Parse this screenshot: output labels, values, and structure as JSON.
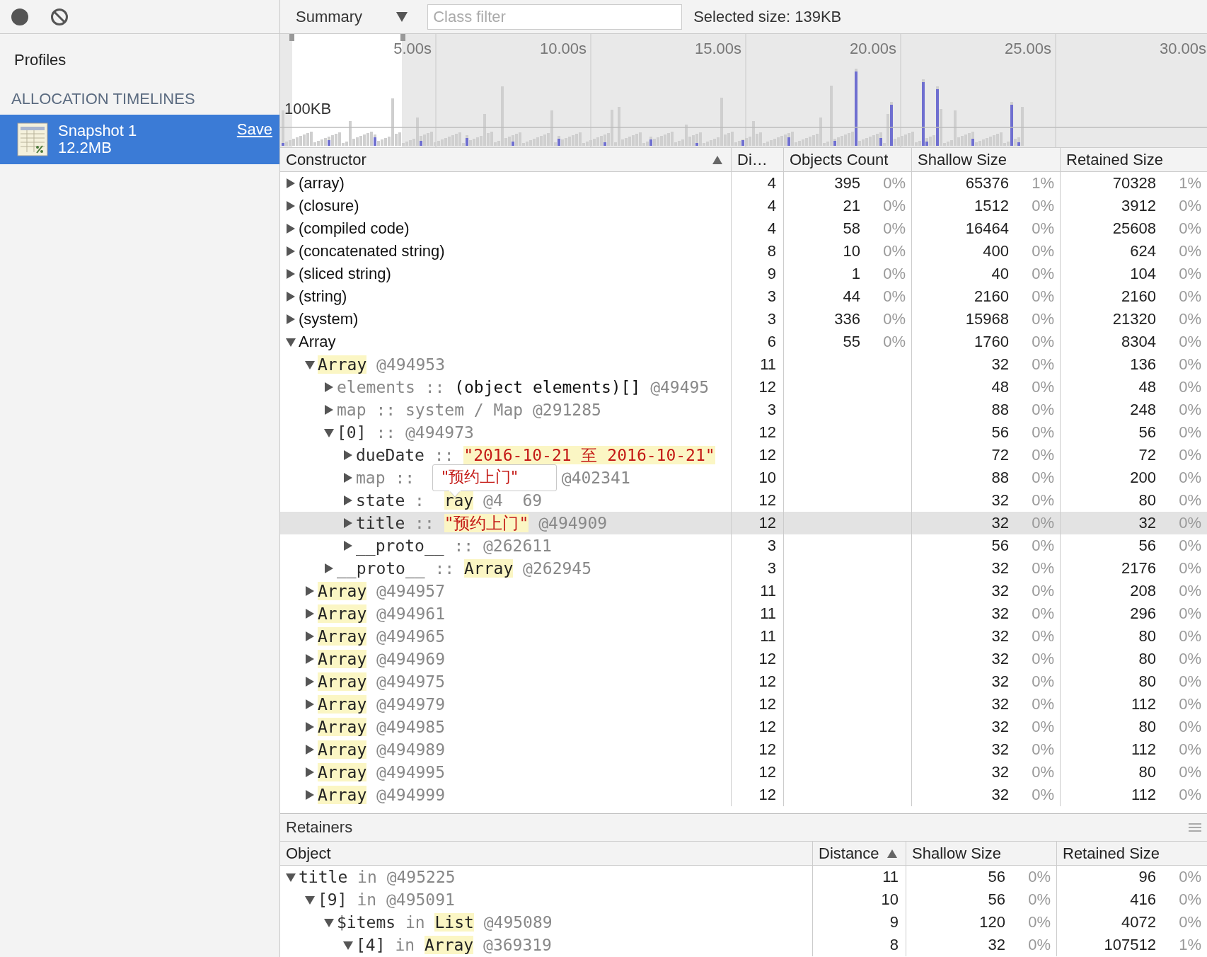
{
  "sidebar": {
    "heading": "Profiles",
    "section": "ALLOCATION TIMELINES",
    "snapshots": [
      {
        "name": "Snapshot 1",
        "size": "12.2MB",
        "action": "Save",
        "selected": true
      }
    ]
  },
  "toolbar": {
    "view": "Summary",
    "filter_placeholder": "Class filter",
    "selected_size": "Selected size: 139KB"
  },
  "timeline": {
    "ticks": [
      "5.00s",
      "10.00s",
      "15.00s",
      "20.00s",
      "25.00s",
      "30.00s"
    ],
    "scale_label": "100KB"
  },
  "table": {
    "columns": [
      {
        "label": "Constructor",
        "sorted": true
      },
      {
        "label": "Di…",
        "sorted": false
      },
      {
        "label": "Objects Count",
        "sorted": false
      },
      {
        "label": "Shallow Size",
        "sorted": false
      },
      {
        "label": "Retained Size",
        "sorted": false
      }
    ],
    "rows": [
      {
        "kind": "constructor",
        "parts": [
          {
            "text": "(array)",
            "kind": "plain"
          }
        ],
        "expanded": false,
        "selected": false,
        "distance": "4",
        "count": "395",
        "count_pct": "0%",
        "shallow": "65376",
        "shallow_pct": "1%",
        "retained": "70328",
        "retained_pct": "1%"
      },
      {
        "kind": "constructor",
        "parts": [
          {
            "text": "(closure)",
            "kind": "plain"
          }
        ],
        "expanded": false,
        "selected": false,
        "distance": "4",
        "count": "21",
        "count_pct": "0%",
        "shallow": "1512",
        "shallow_pct": "0%",
        "retained": "3912",
        "retained_pct": "0%"
      },
      {
        "kind": "constructor",
        "parts": [
          {
            "text": "(compiled code)",
            "kind": "plain"
          }
        ],
        "expanded": false,
        "selected": false,
        "distance": "4",
        "count": "58",
        "count_pct": "0%",
        "shallow": "16464",
        "shallow_pct": "0%",
        "retained": "25608",
        "retained_pct": "0%"
      },
      {
        "kind": "constructor",
        "parts": [
          {
            "text": "(concatenated string)",
            "kind": "plain"
          }
        ],
        "expanded": false,
        "selected": false,
        "distance": "8",
        "count": "10",
        "count_pct": "0%",
        "shallow": "400",
        "shallow_pct": "0%",
        "retained": "624",
        "retained_pct": "0%"
      },
      {
        "kind": "constructor",
        "parts": [
          {
            "text": "(sliced string)",
            "kind": "plain"
          }
        ],
        "expanded": false,
        "selected": false,
        "distance": "9",
        "count": "1",
        "count_pct": "0%",
        "shallow": "40",
        "shallow_pct": "0%",
        "retained": "104",
        "retained_pct": "0%"
      },
      {
        "kind": "constructor",
        "parts": [
          {
            "text": "(string)",
            "kind": "plain"
          }
        ],
        "expanded": false,
        "selected": false,
        "distance": "3",
        "count": "44",
        "count_pct": "0%",
        "shallow": "2160",
        "shallow_pct": "0%",
        "retained": "2160",
        "retained_pct": "0%"
      },
      {
        "kind": "constructor",
        "parts": [
          {
            "text": "(system)",
            "kind": "plain"
          }
        ],
        "expanded": false,
        "selected": false,
        "distance": "3",
        "count": "336",
        "count_pct": "0%",
        "shallow": "15968",
        "shallow_pct": "0%",
        "retained": "21320",
        "retained_pct": "0%"
      },
      {
        "kind": "constructor",
        "parts": [
          {
            "text": "Array",
            "kind": "plain"
          }
        ],
        "expanded": true,
        "selected": false,
        "distance": "6",
        "count": "55",
        "count_pct": "0%",
        "shallow": "1760",
        "shallow_pct": "0%",
        "retained": "8304",
        "retained_pct": "0%",
        "children": [
          {
            "kind": "object",
            "parts": [
              {
                "text": "Array",
                "kind": "class"
              },
              {
                "text": "@494953",
                "kind": "id"
              }
            ],
            "expanded": true,
            "selected": false,
            "distance": "11",
            "shallow": "32",
            "shallow_pct": "0%",
            "retained": "136",
            "retained_pct": "0%",
            "children": [
              {
                "kind": "object",
                "parts": [
                  {
                    "text": "elements",
                    "kind": "hidden-key"
                  },
                  {
                    "text": "::",
                    "kind": "sep"
                  },
                  {
                    "text": "(object elements)[]",
                    "kind": "plain"
                  },
                  {
                    "text": "@49495",
                    "kind": "id"
                  }
                ],
                "expanded": false,
                "selected": false,
                "distance": "12",
                "shallow": "48",
                "shallow_pct": "0%",
                "retained": "48",
                "retained_pct": "0%"
              },
              {
                "kind": "object",
                "parts": [
                  {
                    "text": "map",
                    "kind": "hidden-key"
                  },
                  {
                    "text": "::",
                    "kind": "sep"
                  },
                  {
                    "text": "system / Map",
                    "kind": "dim"
                  },
                  {
                    "text": "@291285",
                    "kind": "id"
                  }
                ],
                "expanded": false,
                "selected": false,
                "distance": "3",
                "shallow": "88",
                "shallow_pct": "0%",
                "retained": "248",
                "retained_pct": "0%"
              },
              {
                "kind": "object",
                "parts": [
                  {
                    "text": "[0]",
                    "kind": "key"
                  },
                  {
                    "text": "::",
                    "kind": "sep"
                  },
                  {
                    "text": "@494973",
                    "kind": "id"
                  }
                ],
                "expanded": true,
                "selected": false,
                "distance": "12",
                "shallow": "56",
                "shallow_pct": "0%",
                "retained": "56",
                "retained_pct": "0%",
                "children": [
                  {
                    "kind": "object",
                    "parts": [
                      {
                        "text": "dueDate",
                        "kind": "key"
                      },
                      {
                        "text": "::",
                        "kind": "sep"
                      },
                      {
                        "text": "\"2016-10-21 至 2016-10-21\"",
                        "kind": "string"
                      }
                    ],
                    "expanded": false,
                    "selected": false,
                    "distance": "12",
                    "shallow": "72",
                    "shallow_pct": "0%",
                    "retained": "72",
                    "retained_pct": "0%"
                  },
                  {
                    "kind": "object",
                    "parts": [
                      {
                        "text": "map",
                        "kind": "hidden-key"
                      },
                      {
                        "text": "::",
                        "kind": "sep"
                      },
                      {
                        "text": "@402341",
                        "kind": "id",
                        "after_cover": true
                      }
                    ],
                    "expanded": false,
                    "selected": false,
                    "distance": "10",
                    "shallow": "88",
                    "shallow_pct": "0%",
                    "retained": "200",
                    "retained_pct": "0%"
                  },
                  {
                    "kind": "object",
                    "parts": [
                      {
                        "text": "state",
                        "kind": "key"
                      },
                      {
                        "text": ":",
                        "kind": "sep"
                      },
                      {
                        "text": "ray",
                        "kind": "class",
                        "after_cover": true
                      },
                      {
                        "text": "@4",
                        "kind": "id"
                      },
                      {
                        "text": "69",
                        "kind": "id",
                        "after_cover": true
                      }
                    ],
                    "expanded": false,
                    "selected": false,
                    "distance": "12",
                    "shallow": "32",
                    "shallow_pct": "0%",
                    "retained": "80",
                    "retained_pct": "0%"
                  },
                  {
                    "kind": "object",
                    "parts": [
                      {
                        "text": "title",
                        "kind": "key"
                      },
                      {
                        "text": "::",
                        "kind": "sep"
                      },
                      {
                        "text": "\"预约上门\"",
                        "kind": "string"
                      },
                      {
                        "text": "@494909",
                        "kind": "id"
                      }
                    ],
                    "expanded": false,
                    "selected": true,
                    "distance": "12",
                    "shallow": "32",
                    "shallow_pct": "0%",
                    "retained": "32",
                    "retained_pct": "0%"
                  },
                  {
                    "kind": "object",
                    "parts": [
                      {
                        "text": "__proto__",
                        "kind": "key"
                      },
                      {
                        "text": "::",
                        "kind": "sep"
                      },
                      {
                        "text": "@262611",
                        "kind": "id"
                      }
                    ],
                    "expanded": false,
                    "selected": false,
                    "distance": "3",
                    "shallow": "56",
                    "shallow_pct": "0%",
                    "retained": "56",
                    "retained_pct": "0%"
                  }
                ]
              },
              {
                "kind": "object",
                "parts": [
                  {
                    "text": "__proto__",
                    "kind": "key"
                  },
                  {
                    "text": "::",
                    "kind": "sep"
                  },
                  {
                    "text": "Array",
                    "kind": "class"
                  },
                  {
                    "text": "@262945",
                    "kind": "id"
                  }
                ],
                "expanded": false,
                "selected": false,
                "distance": "3",
                "shallow": "32",
                "shallow_pct": "0%",
                "retained": "2176",
                "retained_pct": "0%"
              }
            ]
          },
          {
            "kind": "object",
            "parts": [
              {
                "text": "Array",
                "kind": "class"
              },
              {
                "text": "@494957",
                "kind": "id"
              }
            ],
            "expanded": false,
            "selected": false,
            "distance": "11",
            "shallow": "32",
            "shallow_pct": "0%",
            "retained": "208",
            "retained_pct": "0%"
          },
          {
            "kind": "object",
            "parts": [
              {
                "text": "Array",
                "kind": "class"
              },
              {
                "text": "@494961",
                "kind": "id"
              }
            ],
            "expanded": false,
            "selected": false,
            "distance": "11",
            "shallow": "32",
            "shallow_pct": "0%",
            "retained": "296",
            "retained_pct": "0%"
          },
          {
            "kind": "object",
            "parts": [
              {
                "text": "Array",
                "kind": "class"
              },
              {
                "text": "@494965",
                "kind": "id"
              }
            ],
            "expanded": false,
            "selected": false,
            "distance": "11",
            "shallow": "32",
            "shallow_pct": "0%",
            "retained": "80",
            "retained_pct": "0%"
          },
          {
            "kind": "object",
            "parts": [
              {
                "text": "Array",
                "kind": "class"
              },
              {
                "text": "@494969",
                "kind": "id"
              }
            ],
            "expanded": false,
            "selected": false,
            "distance": "12",
            "shallow": "32",
            "shallow_pct": "0%",
            "retained": "80",
            "retained_pct": "0%"
          },
          {
            "kind": "object",
            "parts": [
              {
                "text": "Array",
                "kind": "class"
              },
              {
                "text": "@494975",
                "kind": "id"
              }
            ],
            "expanded": false,
            "selected": false,
            "distance": "12",
            "shallow": "32",
            "shallow_pct": "0%",
            "retained": "80",
            "retained_pct": "0%"
          },
          {
            "kind": "object",
            "parts": [
              {
                "text": "Array",
                "kind": "class"
              },
              {
                "text": "@494979",
                "kind": "id"
              }
            ],
            "expanded": false,
            "selected": false,
            "distance": "12",
            "shallow": "32",
            "shallow_pct": "0%",
            "retained": "112",
            "retained_pct": "0%"
          },
          {
            "kind": "object",
            "parts": [
              {
                "text": "Array",
                "kind": "class"
              },
              {
                "text": "@494985",
                "kind": "id"
              }
            ],
            "expanded": false,
            "selected": false,
            "distance": "12",
            "shallow": "32",
            "shallow_pct": "0%",
            "retained": "80",
            "retained_pct": "0%"
          },
          {
            "kind": "object",
            "parts": [
              {
                "text": "Array",
                "kind": "class"
              },
              {
                "text": "@494989",
                "kind": "id"
              }
            ],
            "expanded": false,
            "selected": false,
            "distance": "12",
            "shallow": "32",
            "shallow_pct": "0%",
            "retained": "112",
            "retained_pct": "0%"
          },
          {
            "kind": "object",
            "parts": [
              {
                "text": "Array",
                "kind": "class"
              },
              {
                "text": "@494995",
                "kind": "id"
              }
            ],
            "expanded": false,
            "selected": false,
            "distance": "12",
            "shallow": "32",
            "shallow_pct": "0%",
            "retained": "80",
            "retained_pct": "0%"
          },
          {
            "kind": "object",
            "parts": [
              {
                "text": "Array",
                "kind": "class"
              },
              {
                "text": "@494999",
                "kind": "id"
              }
            ],
            "expanded": false,
            "selected": false,
            "distance": "12",
            "shallow": "32",
            "shallow_pct": "0%",
            "retained": "112",
            "retained_pct": "0%"
          }
        ]
      }
    ]
  },
  "tooltip": {
    "text": "\"预约上门\""
  },
  "retainers": {
    "title": "Retainers",
    "columns": [
      {
        "label": "Object",
        "sorted": false
      },
      {
        "label": "Distance",
        "sorted": true
      },
      {
        "label": "Shallow Size",
        "sorted": false
      },
      {
        "label": "Retained Size",
        "sorted": false
      }
    ],
    "rows": [
      {
        "parts": [
          {
            "text": "title",
            "kind": "key"
          },
          {
            "text": "in",
            "kind": "sep"
          },
          {
            "text": "@495225",
            "kind": "id"
          }
        ],
        "expanded": true,
        "distance": "11",
        "shallow": "56",
        "shallow_pct": "0%",
        "retained": "96",
        "retained_pct": "0%",
        "children": [
          {
            "parts": [
              {
                "text": "[9]",
                "kind": "key"
              },
              {
                "text": "in",
                "kind": "sep"
              },
              {
                "text": "@495091",
                "kind": "id"
              }
            ],
            "expanded": true,
            "distance": "10",
            "shallow": "56",
            "shallow_pct": "0%",
            "retained": "416",
            "retained_pct": "0%",
            "children": [
              {
                "parts": [
                  {
                    "text": "$items",
                    "kind": "key"
                  },
                  {
                    "text": "in",
                    "kind": "sep"
                  },
                  {
                    "text": "List",
                    "kind": "class"
                  },
                  {
                    "text": "@495089",
                    "kind": "id"
                  }
                ],
                "expanded": true,
                "distance": "9",
                "shallow": "120",
                "shallow_pct": "0%",
                "retained": "4072",
                "retained_pct": "0%",
                "children": [
                  {
                    "parts": [
                      {
                        "text": "[4]",
                        "kind": "key"
                      },
                      {
                        "text": "in",
                        "kind": "sep"
                      },
                      {
                        "text": "Array",
                        "kind": "class"
                      },
                      {
                        "text": "@369319",
                        "kind": "id"
                      }
                    ],
                    "expanded": true,
                    "distance": "8",
                    "shallow": "32",
                    "shallow_pct": "0%",
                    "retained": "107512",
                    "retained_pct": "1%"
                  }
                ]
              }
            ]
          }
        ]
      }
    ]
  }
}
